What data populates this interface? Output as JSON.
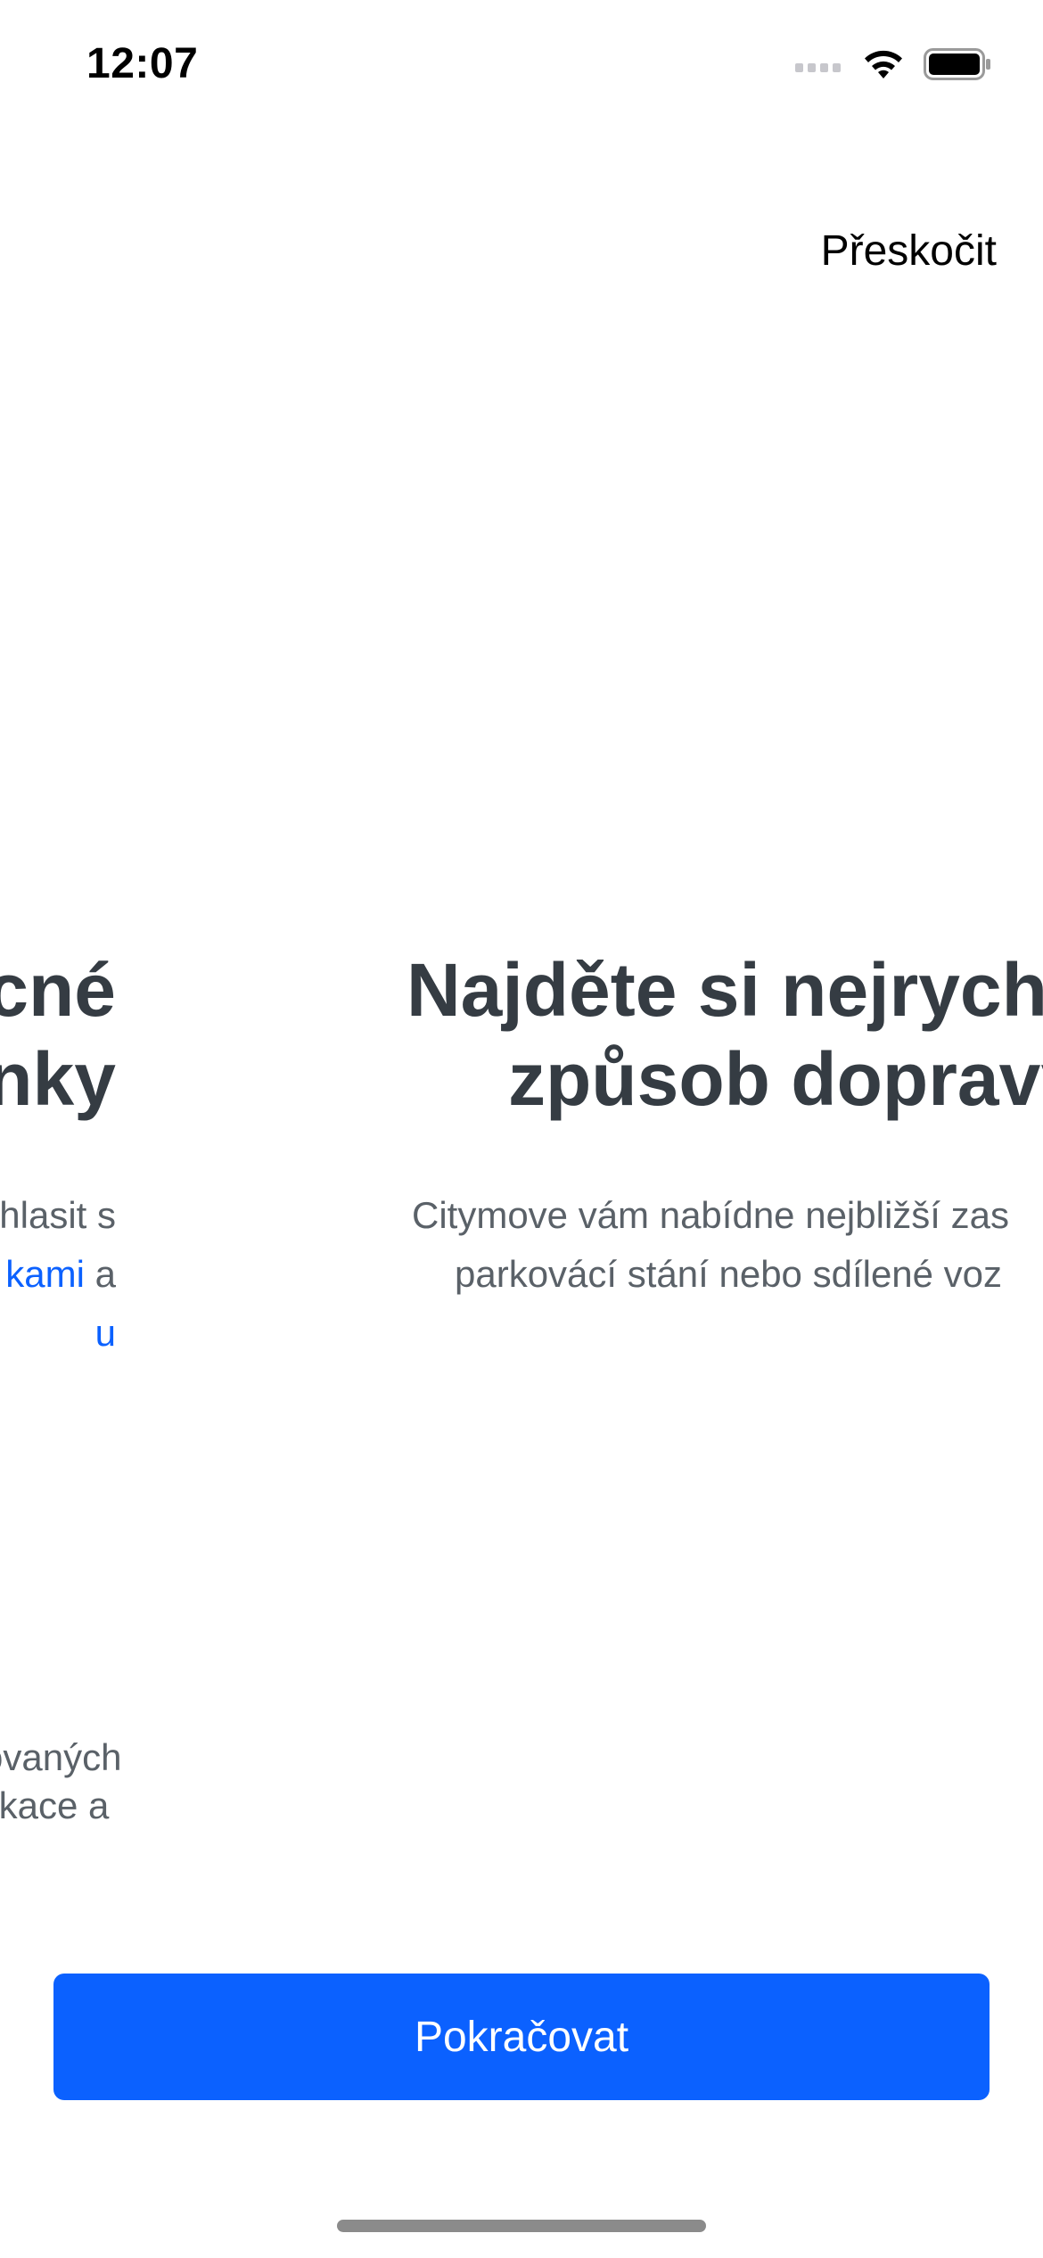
{
  "status_bar": {
    "time": "12:07",
    "signal_icon": "cellular-signal-icon",
    "wifi_icon": "wifi-icon",
    "battery_icon": "battery-icon"
  },
  "header": {
    "skip_label": "Přeskočit"
  },
  "slides": {
    "previous": {
      "title_line1": "cné",
      "title_line2": "nky",
      "body_line1": "e souhlasit s",
      "body_line2_link": "kami",
      "body_line2_suffix": " a",
      "body_line3_link": "u",
      "footnote_line1": "ovaných",
      "footnote_line2": "likace a"
    },
    "current": {
      "title_line1": "Najděte si nejrychl",
      "title_line2": "způsob dopravy",
      "body_line1": "Citymove vám nabídne nejbližší zas",
      "body_line2": "parkovácí stání nebo sdílené voz"
    }
  },
  "footer": {
    "continue_label": "Pokračovat"
  },
  "colors": {
    "accent": "#0b61ff",
    "title": "#353c43",
    "body": "#5a6168"
  }
}
